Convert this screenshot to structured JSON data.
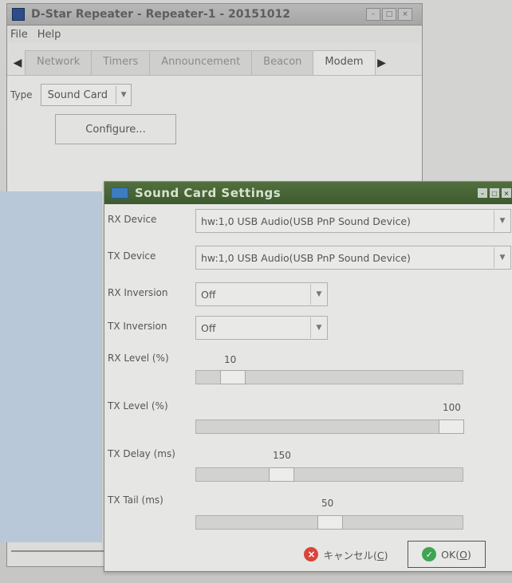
{
  "main_window": {
    "title": "D-Star Repeater - Repeater-1 - 20151012",
    "menu": [
      "File",
      "Help"
    ],
    "tabs": [
      "Network",
      "Timers",
      "Announcement",
      "Beacon",
      "Modem"
    ],
    "active_tab": "Modem",
    "type_label": "Type",
    "type_value": "Sound Card",
    "configure_label": "Configure..."
  },
  "dialog": {
    "title": "Sound Card Settings",
    "rx_device": {
      "label": "RX Device",
      "value": "hw:1,0 USB Audio(USB PnP Sound Device)"
    },
    "tx_device": {
      "label": "TX Device",
      "value": "hw:1,0 USB Audio(USB PnP Sound Device)"
    },
    "rx_inversion": {
      "label": "RX Inversion",
      "value": "Off"
    },
    "tx_inversion": {
      "label": "TX Inversion",
      "value": "Off"
    },
    "rx_level": {
      "label": "RX Level (%)",
      "value": "10",
      "fraction": 0.1
    },
    "tx_level": {
      "label": "TX Level (%)",
      "value": "100",
      "fraction": 1.0
    },
    "tx_delay": {
      "label": "TX Delay (ms)",
      "value": "150",
      "fraction": 0.3
    },
    "tx_tail": {
      "label": "TX Tail (ms)",
      "value": "50",
      "fraction": 0.5
    },
    "cancel_label": "キャンセル(",
    "cancel_mnemonic": "C",
    "cancel_suffix": ")",
    "ok_label": "OK(",
    "ok_mnemonic": "O",
    "ok_suffix": ")"
  },
  "colors": {
    "dialog_titlebar": "#3d5b2e",
    "cancel_icon": "#d9443a",
    "ok_icon": "#3ea550"
  }
}
